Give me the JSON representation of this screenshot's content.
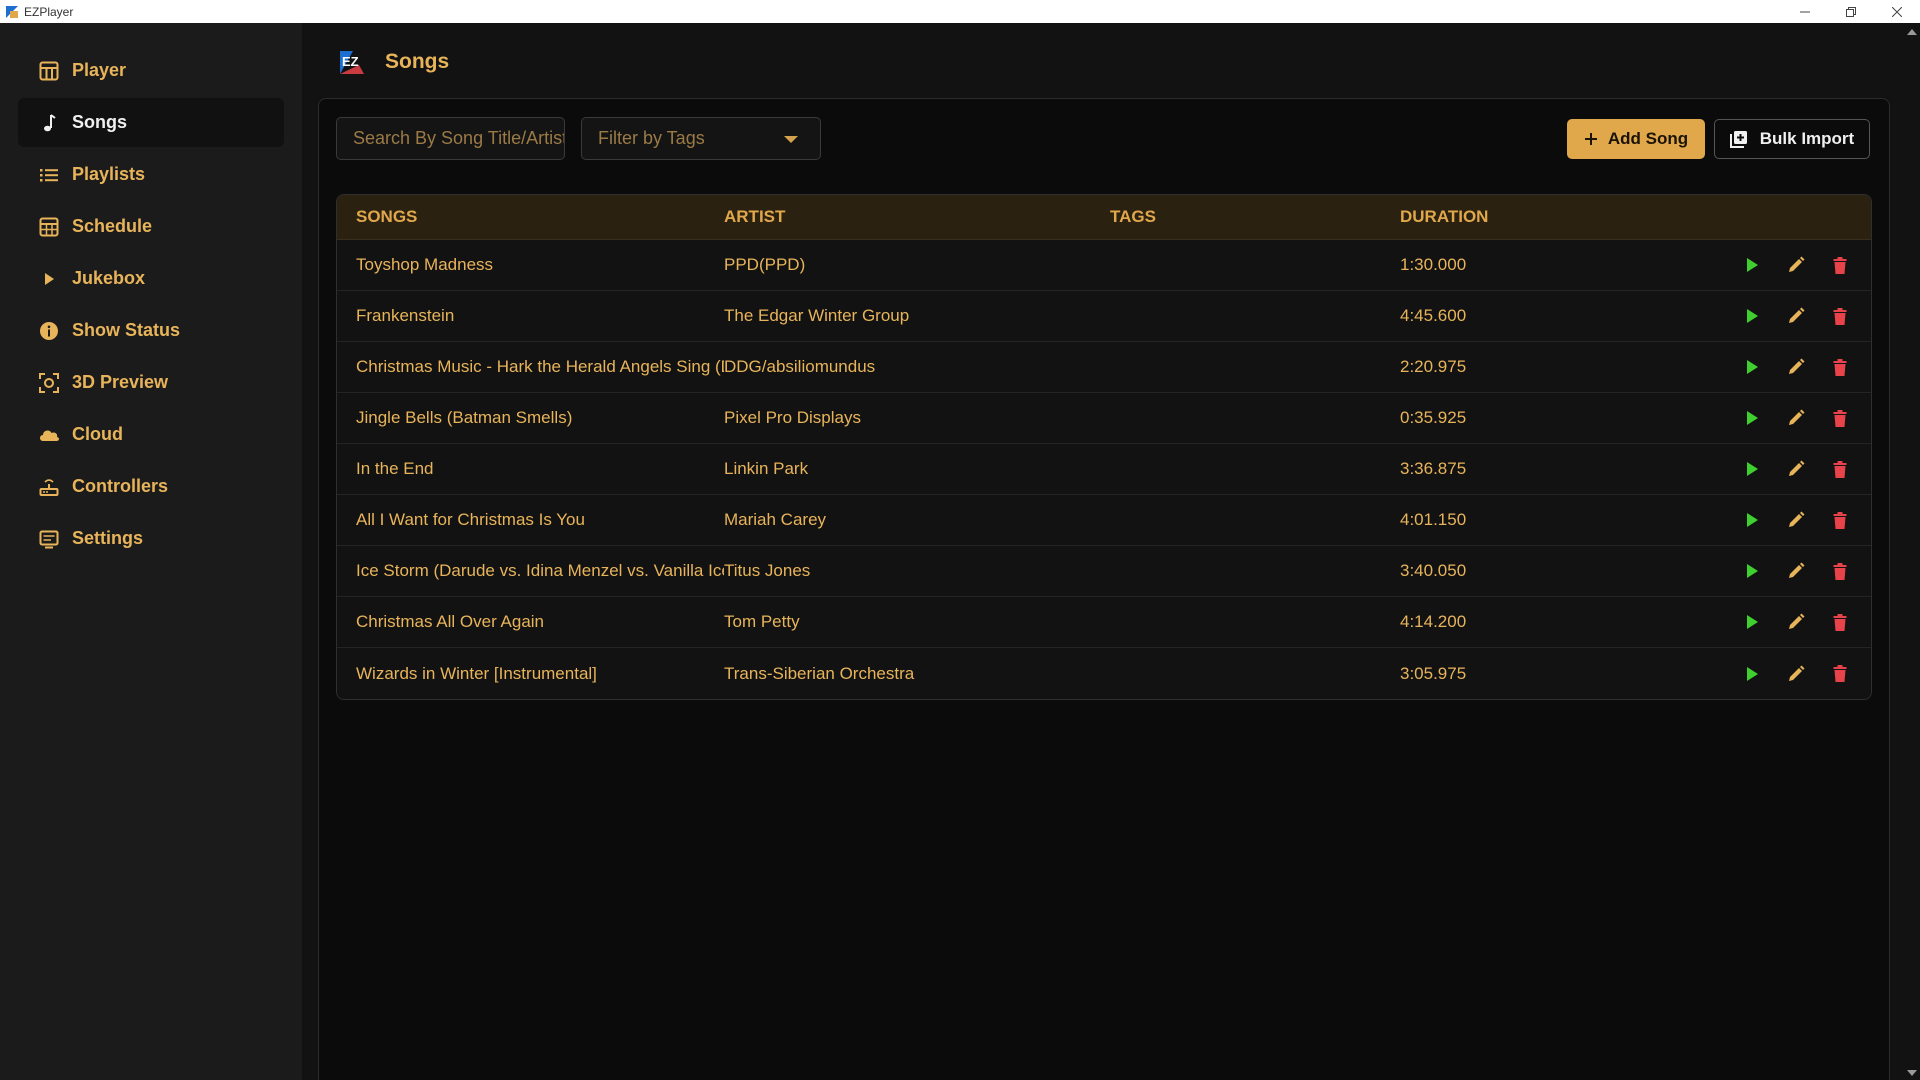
{
  "window": {
    "title": "EZPlayer"
  },
  "colors": {
    "accent": "#e0a84a",
    "play": "#3fcf2f",
    "delete": "#e8434a",
    "edit": "#e8b45a"
  },
  "sidebar": {
    "items": [
      {
        "label": "Player",
        "icon": "table-icon"
      },
      {
        "label": "Songs",
        "icon": "music-note-icon",
        "active": true
      },
      {
        "label": "Playlists",
        "icon": "list-icon"
      },
      {
        "label": "Schedule",
        "icon": "calendar-grid-icon"
      },
      {
        "label": "Jukebox",
        "icon": "play-triangle-icon"
      },
      {
        "label": "Show Status",
        "icon": "info-icon"
      },
      {
        "label": "3D Preview",
        "icon": "3d-view-icon"
      },
      {
        "label": "Cloud",
        "icon": "cloud-icon"
      },
      {
        "label": "Controllers",
        "icon": "router-icon"
      },
      {
        "label": "Settings",
        "icon": "settings-screen-icon"
      }
    ]
  },
  "header": {
    "title": "Songs"
  },
  "toolbar": {
    "search_placeholder": "Search By Song Title/Artist",
    "filter_placeholder": "Filter by Tags",
    "add_label": "Add Song",
    "bulk_label": "Bulk Import"
  },
  "table": {
    "columns": [
      "SONGS",
      "ARTIST",
      "TAGS",
      "DURATION"
    ],
    "rows": [
      {
        "song": "Toyshop Madness",
        "artist": "PPD(PPD)",
        "tags": "",
        "duration": "1:30.000"
      },
      {
        "song": "Frankenstein",
        "artist": "The Edgar Winter Group",
        "tags": "",
        "duration": "4:45.600"
      },
      {
        "song": "Christmas Music - Hark the Herald Angels Sing (D",
        "artist": "DDG/absiliomundus",
        "tags": "",
        "duration": "2:20.975"
      },
      {
        "song": "Jingle Bells (Batman Smells)",
        "artist": "Pixel Pro Displays",
        "tags": "",
        "duration": "0:35.925"
      },
      {
        "song": "In the End",
        "artist": "Linkin Park",
        "tags": "",
        "duration": "3:36.875"
      },
      {
        "song": "All I Want for Christmas Is You",
        "artist": "Mariah Carey",
        "tags": "",
        "duration": "4:01.150"
      },
      {
        "song": "Ice Storm (Darude vs. Idina Menzel vs. Vanilla Ice)",
        "artist": "Titus Jones",
        "tags": "",
        "duration": "3:40.050"
      },
      {
        "song": "Christmas All Over Again",
        "artist": "Tom Petty",
        "tags": "",
        "duration": "4:14.200"
      },
      {
        "song": "Wizards in Winter [Instrumental]",
        "artist": "Trans-Siberian Orchestra",
        "tags": "",
        "duration": "3:05.975"
      }
    ]
  }
}
